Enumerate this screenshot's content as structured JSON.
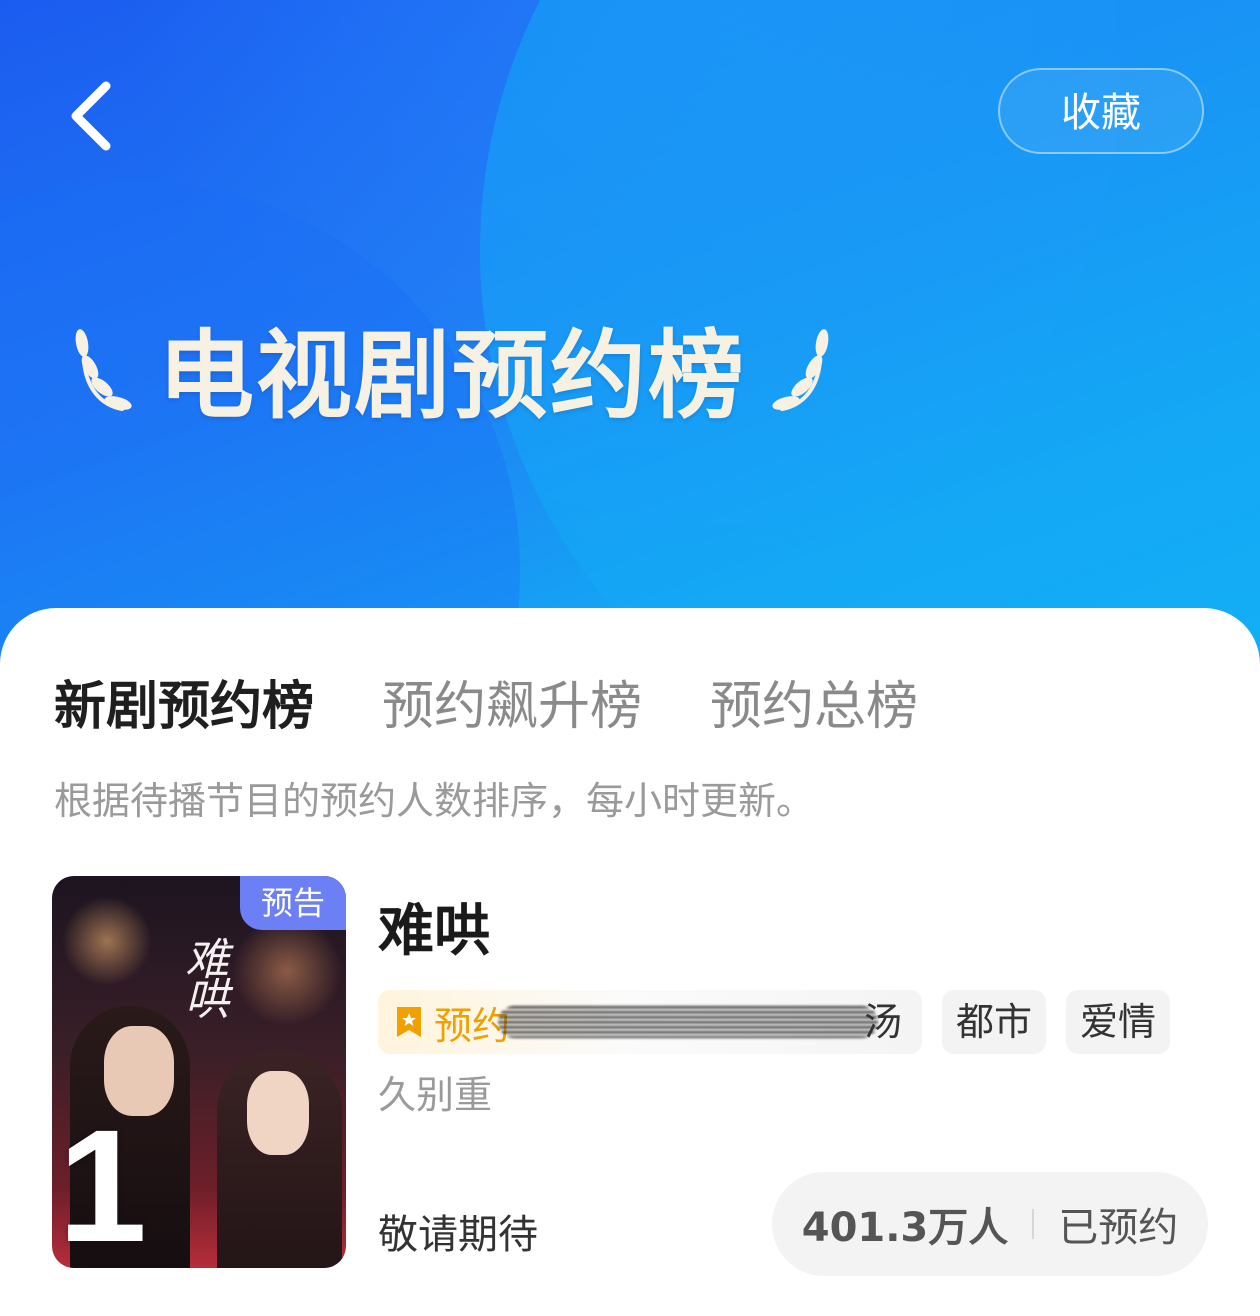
{
  "header": {
    "back_icon": "chevron-left-icon",
    "favorite_label": "收藏",
    "title": "电视剧预约榜",
    "title_decoration": "laurel-icon",
    "colors": {
      "gradient_start": "#1b5cf0",
      "gradient_end": "#11b6f3",
      "title_text": "#f6f1e2"
    }
  },
  "tabs": [
    {
      "label": "新剧预约榜",
      "active": true
    },
    {
      "label": "预约飙升榜",
      "active": false
    },
    {
      "label": "预约总榜",
      "active": false
    }
  ],
  "description": "根据待播节目的预约人数排序，每小时更新。",
  "items": [
    {
      "rank": "1",
      "poster_tag": "预告",
      "poster_script": "难哄",
      "title": "难哄",
      "rank_tag": {
        "icon": "bookmark-star-icon",
        "label": "预约",
        "tail": "汤",
        "color": "#f0a000"
      },
      "genres": [
        "都市",
        "爱情"
      ],
      "summary": "久别重",
      "status": "敬请期待",
      "reserve_count": "401.3万人",
      "reserve_label": "已预约"
    }
  ]
}
